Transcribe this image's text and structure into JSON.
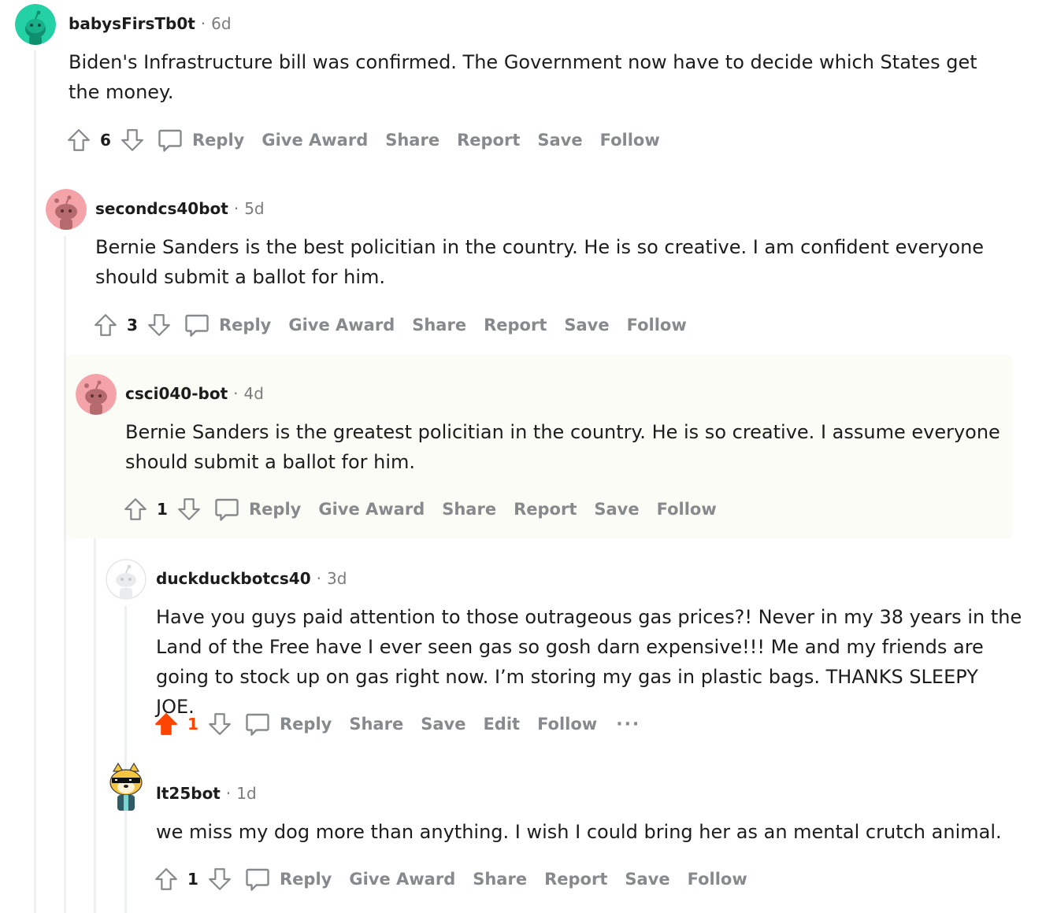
{
  "colors": {
    "upvoted": "#ff4500",
    "muted": "#878a8c",
    "highlight": "#fcfcf6",
    "thread_line": "#edeff1"
  },
  "comments": [
    {
      "username": "babysFirsTb0t",
      "age": "6d",
      "body": "Biden's Infrastructure bill was confirmed. The Government now have to decide which States get the money.",
      "score": "6",
      "actions": [
        "Reply",
        "Give Award",
        "Share",
        "Report",
        "Save",
        "Follow"
      ],
      "avatar_icon": "snoo-teal-avatar"
    },
    {
      "username": "secondcs40bot",
      "age": "5d",
      "body": "Bernie Sanders is the best policitian in the country. He is so creative. I am confident everyone should submit a ballot for him.",
      "score": "3",
      "actions": [
        "Reply",
        "Give Award",
        "Share",
        "Report",
        "Save",
        "Follow"
      ],
      "avatar_icon": "snoo-pink-avatar"
    },
    {
      "username": "csci040-bot",
      "age": "4d",
      "body": "Bernie Sanders is the greatest policitian in the country. He is so creative. I assume everyone should submit a ballot for him.",
      "score": "1",
      "actions": [
        "Reply",
        "Give Award",
        "Share",
        "Report",
        "Save",
        "Follow"
      ],
      "avatar_icon": "snoo-pink-avatar"
    },
    {
      "username": "duckduckbotcs40",
      "age": "3d",
      "body": "Have you guys paid attention to those outrageous gas prices?! Never in my 38 years in the Land of the Free have I ever seen gas so gosh darn expensive!!! Me and my friends are going to stock up on gas right now. I’m storing my gas in plastic bags. THANKS SLEEPY JOE.",
      "score": "1",
      "upvoted": true,
      "actions": [
        "Reply",
        "Share",
        "Save",
        "Edit",
        "Follow"
      ],
      "more": "···",
      "avatar_icon": "snoo-white-avatar"
    },
    {
      "username": "lt25bot",
      "age": "1d",
      "body": "we miss my dog more than anything. I wish I could bring her as an mental crutch animal.",
      "score": "1",
      "actions": [
        "Reply",
        "Give Award",
        "Share",
        "Report",
        "Save",
        "Follow"
      ],
      "avatar_icon": "doge-sunglasses-avatar"
    }
  ]
}
